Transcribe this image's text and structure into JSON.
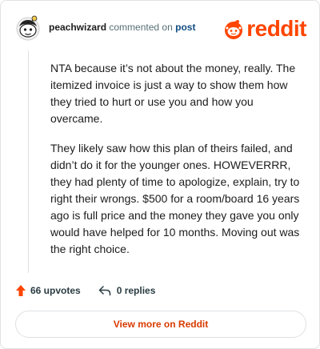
{
  "header": {
    "username": "peachwizard",
    "action_text": "commented on",
    "post_link": "post",
    "brand": "reddit"
  },
  "comment": {
    "paragraphs": [
      "NTA because it’s not about the money, really. The itemized invoice is just a way to show them how they tried to hurt or use you and how you overcame.",
      "They likely saw how this plan of theirs failed, and didn’t do it for the younger ones. HOWEVERRR, they had plenty of time to apologize, explain, try to right their wrongs. $500 for a room/board 16 years ago is full price and the money they gave you only would have helped for 10 months. Moving out was the right choice."
    ]
  },
  "actions": {
    "upvotes_label": "66 upvotes",
    "replies_label": "0 replies"
  },
  "footer": {
    "view_more_label": "View more on Reddit"
  },
  "colors": {
    "brand_orange": "#ff4500",
    "link_blue": "#0f4c81",
    "view_more_red": "#d93a00"
  },
  "icons": {
    "avatar": "snoo-avatar",
    "logo": "reddit-logo-icon",
    "upvote": "upvote-arrow-icon",
    "reply": "reply-arrow-icon"
  }
}
